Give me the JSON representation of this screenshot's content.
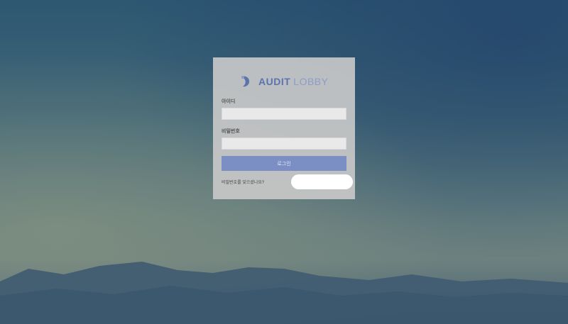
{
  "brand": {
    "name_strong": "AUDIT",
    "name_light": "LOBBY"
  },
  "form": {
    "username_label": "아이디",
    "username_value": "",
    "password_label": "비밀번호",
    "password_value": "",
    "login_label": "로그인"
  },
  "help": {
    "text": "비밀번호를 잊으셨나요?"
  },
  "colors": {
    "accent": "#7c8fc5",
    "card": "#c8c8c8"
  }
}
